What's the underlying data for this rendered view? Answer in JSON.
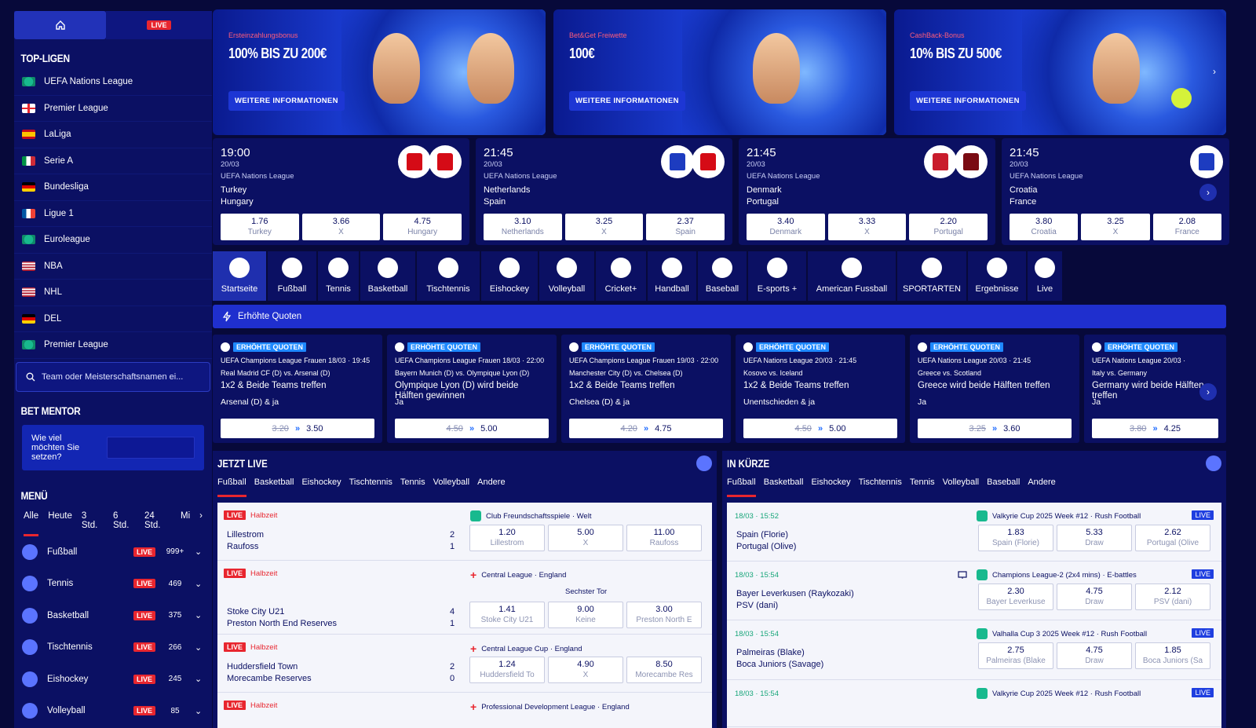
{
  "sidebar": {
    "live_label": "LIVE",
    "top_leagues_title": "TOP-LIGEN",
    "top_leagues": [
      {
        "label": "UEFA Nations League",
        "flag": "globe"
      },
      {
        "label": "Premier League",
        "flag": "england"
      },
      {
        "label": "LaLiga",
        "flag": "spain"
      },
      {
        "label": "Serie A",
        "flag": "italy"
      },
      {
        "label": "Bundesliga",
        "flag": "germany"
      },
      {
        "label": "Ligue 1",
        "flag": "france"
      },
      {
        "label": "Euroleague",
        "flag": "globe"
      },
      {
        "label": "NBA",
        "flag": "usa"
      },
      {
        "label": "NHL",
        "flag": "usa"
      },
      {
        "label": "DEL",
        "flag": "germany"
      },
      {
        "label": "Premier League",
        "flag": "globe"
      }
    ],
    "search_placeholder": "Team oder Meisterschaftsnamen ei...",
    "bet_mentor_title": "BET MENTOR",
    "bet_mentor_question": "Wie viel möchten Sie setzen?",
    "menu_title": "MENÜ",
    "menu_tabs": [
      "Alle",
      "Heute",
      "3 Std.",
      "6 Std.",
      "24 Std.",
      "Mi"
    ],
    "sports": [
      {
        "label": "Fußball",
        "count": "999+"
      },
      {
        "label": "Tennis",
        "count": "469"
      },
      {
        "label": "Basketball",
        "count": "375"
      },
      {
        "label": "Tischtennis",
        "count": "266"
      },
      {
        "label": "Eishockey",
        "count": "245"
      },
      {
        "label": "Volleyball",
        "count": "85"
      }
    ]
  },
  "banners": [
    {
      "pre": "Ersteinzahlungsbonus",
      "big": "100% BIS ZU 200€",
      "cta": "WEITERE INFORMATIONEN"
    },
    {
      "pre": "Bet&Get Freiwette",
      "big": "100€",
      "cta": "WEITERE INFORMATIONEN"
    },
    {
      "pre": "CashBack-Bonus",
      "big": "10% BIS ZU 500€",
      "cta": "WEITERE INFORMATIONEN"
    }
  ],
  "matches": [
    {
      "time": "19:00",
      "date": "20/03",
      "league": "UEFA Nations League",
      "team1": "Turkey",
      "team2": "Hungary",
      "odds": [
        {
          "v": "1.76",
          "l": "Turkey"
        },
        {
          "v": "3.66",
          "l": "X"
        },
        {
          "v": "4.75",
          "l": "Hungary"
        }
      ]
    },
    {
      "time": "21:45",
      "date": "20/03",
      "league": "UEFA Nations League",
      "team1": "Netherlands",
      "team2": "Spain",
      "odds": [
        {
          "v": "3.10",
          "l": "Netherlands"
        },
        {
          "v": "3.25",
          "l": "X"
        },
        {
          "v": "2.37",
          "l": "Spain"
        }
      ]
    },
    {
      "time": "21:45",
      "date": "20/03",
      "league": "UEFA Nations League",
      "team1": "Denmark",
      "team2": "Portugal",
      "odds": [
        {
          "v": "3.40",
          "l": "Denmark"
        },
        {
          "v": "3.33",
          "l": "X"
        },
        {
          "v": "2.20",
          "l": "Portugal"
        }
      ]
    },
    {
      "time": "21:45",
      "date": "20/03",
      "league": "UEFA Nations League",
      "team1": "Croatia",
      "team2": "France",
      "odds": [
        {
          "v": "3.80",
          "l": "Croatia"
        },
        {
          "v": "3.25",
          "l": "X"
        },
        {
          "v": "2.08",
          "l": "France"
        }
      ]
    }
  ],
  "sport_nav": [
    "Startseite",
    "Fußball",
    "Tennis",
    "Basketball",
    "Tischtennis",
    "Eishockey",
    "Volleyball",
    "Cricket+",
    "Handball",
    "Baseball",
    "E-sports +",
    "American Fussball",
    "SPORTARTEN",
    "Ergebnisse",
    "Live"
  ],
  "boosted_title": "Erhöhte Quoten",
  "boosted": [
    {
      "badge": "ERHÖHTE QUOTEN",
      "l1": "UEFA Champions League Frauen 18/03 · 19:45",
      "l2": "Real Madrid CF (D) vs. Arsenal (D)",
      "l3": "1x2 & Beide Teams treffen",
      "l4": "Arsenal (D) & ja",
      "old": "3.20",
      "new": "3.50"
    },
    {
      "badge": "ERHÖHTE QUOTEN",
      "l1": "UEFA Champions League Frauen 18/03 · 22:00",
      "l2": "Bayern Munich (D) vs. Olympique Lyon (D)",
      "l3": "Olympique Lyon (D) wird beide Hälften gewinnen",
      "l4": "Ja",
      "old": "4.50",
      "new": "5.00"
    },
    {
      "badge": "ERHÖHTE QUOTEN",
      "l1": "UEFA Champions League Frauen 19/03 · 22:00",
      "l2": "Manchester City (D) vs. Chelsea (D)",
      "l3": "1x2 & Beide Teams treffen",
      "l4": "Chelsea (D) & ja",
      "old": "4.20",
      "new": "4.75"
    },
    {
      "badge": "ERHÖHTE QUOTEN",
      "l1": "UEFA Nations League          20/03 · 21:45",
      "l2": "Kosovo vs. Iceland",
      "l3": "1x2 & Beide Teams treffen",
      "l4": "Unentschieden & ja",
      "old": "4.50",
      "new": "5.00"
    },
    {
      "badge": "ERHÖHTE QUOTEN",
      "l1": "UEFA Nations League          20/03 · 21:45",
      "l2": "Greece vs. Scotland",
      "l3": "Greece wird beide Hälften treffen",
      "l4": "Ja",
      "old": "3.25",
      "new": "3.60"
    },
    {
      "badge": "ERHÖHTE QUOTEN",
      "l1": "UEFA Nations League          20/03 ·",
      "l2": "Italy vs. Germany",
      "l3": "Germany wird beide Hälften treffen",
      "l4": "Ja",
      "old": "3.80",
      "new": "4.25"
    }
  ],
  "jetzt_live": {
    "title": "JETZT LIVE",
    "tabs": [
      "Fußball",
      "Basketball",
      "Eishockey",
      "Tischtennis",
      "Tennis",
      "Volleyball",
      "Andere"
    ],
    "events": [
      {
        "live": "LIVE",
        "status": "Halbzeit",
        "league": "Club Freundschaftsspiele · Welt",
        "extra": "",
        "team1": "Lillestrom",
        "team2": "Raufoss",
        "s1": "2",
        "s2": "1",
        "odds": [
          {
            "v": "1.20",
            "l": "Lillestrom"
          },
          {
            "v": "5.00",
            "l": "X"
          },
          {
            "v": "11.00",
            "l": "Raufoss"
          }
        ]
      },
      {
        "live": "LIVE",
        "status": "Halbzeit",
        "league": "Central League · England",
        "extra": "Sechster Tor",
        "team1": "Stoke City U21",
        "team2": "Preston North End Reserves",
        "s1": "4",
        "s2": "1",
        "odds": [
          {
            "v": "1.41",
            "l": "Stoke City U21"
          },
          {
            "v": "9.00",
            "l": "Keine"
          },
          {
            "v": "3.00",
            "l": "Preston North E"
          }
        ]
      },
      {
        "live": "LIVE",
        "status": "Halbzeit",
        "league": "Central League Cup · England",
        "extra": "",
        "team1": "Huddersfield Town",
        "team2": "Morecambe Reserves",
        "s1": "2",
        "s2": "0",
        "odds": [
          {
            "v": "1.24",
            "l": "Huddersfield To"
          },
          {
            "v": "4.90",
            "l": "X"
          },
          {
            "v": "8.50",
            "l": "Morecambe Res"
          }
        ]
      },
      {
        "live": "LIVE",
        "status": "Halbzeit",
        "league": "Professional Development League · England",
        "extra": "",
        "team1": "",
        "team2": "",
        "s1": "",
        "s2": "",
        "odds": []
      }
    ]
  },
  "in_kuerze": {
    "title": "IN KÜRZE",
    "tabs": [
      "Fußball",
      "Basketball",
      "Eishockey",
      "Tischtennis",
      "Tennis",
      "Volleyball",
      "Baseball",
      "Andere"
    ],
    "live": "LIVE",
    "events": [
      {
        "time": "18/03 · 15:52",
        "league": "Valkyrie Cup 2025 Week #12 · Rush Football",
        "team1": "Spain (Florie)",
        "team2": "Portugal (Olive)",
        "odds": [
          {
            "v": "1.83",
            "l": "Spain (Florie)"
          },
          {
            "v": "5.33",
            "l": "Draw"
          },
          {
            "v": "2.62",
            "l": "Portugal (Olive"
          }
        ]
      },
      {
        "time": "18/03 · 15:54",
        "league": "Champions League-2 (2x4 mins) · E-battles",
        "team1": "Bayer Leverkusen (Raykozaki)",
        "team2": "PSV (dani)",
        "odds": [
          {
            "v": "2.30",
            "l": "Bayer Leverkuse"
          },
          {
            "v": "4.75",
            "l": "Draw"
          },
          {
            "v": "2.12",
            "l": "PSV (dani)"
          }
        ]
      },
      {
        "time": "18/03 · 15:54",
        "league": "Valhalla Cup 3 2025 Week #12 · Rush Football",
        "team1": "Palmeiras (Blake)",
        "team2": "Boca Juniors (Savage)",
        "odds": [
          {
            "v": "2.75",
            "l": "Palmeiras (Blake"
          },
          {
            "v": "4.75",
            "l": "Draw"
          },
          {
            "v": "1.85",
            "l": "Boca Juniors (Sa"
          }
        ]
      },
      {
        "time": "18/03 · 15:54",
        "league": "Valkyrie Cup 2025 Week #12 · Rush Football",
        "team1": "",
        "team2": "",
        "odds": []
      }
    ]
  },
  "colors": {
    "bg": "#07093a",
    "panel": "#0b1063",
    "accent": "#1f2fce",
    "live": "#e8262f",
    "esport": "#18b98e"
  }
}
